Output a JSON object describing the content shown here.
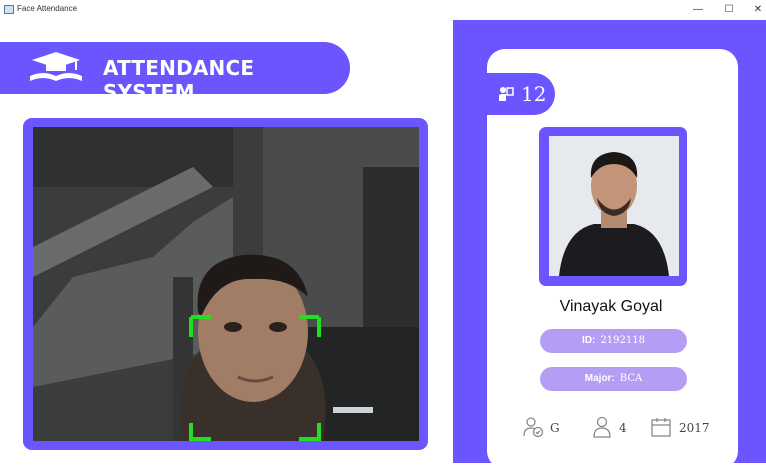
{
  "window": {
    "title": "Face Attendance",
    "minimize": "—",
    "maximize": "☐",
    "close": "✕"
  },
  "banner": {
    "title": "ATTENDANCE SYSTEM"
  },
  "student": {
    "total_attendance": "12",
    "name": "Vinayak Goyal",
    "id_label": "ID:",
    "id_value": "2192118",
    "major_label": "Major:",
    "major_value": "BCA",
    "standing": "G",
    "year": "4",
    "starting_year": "2017"
  },
  "colors": {
    "accent": "#6b55ff",
    "pill": "#b49ef5",
    "detector": "#22dd22"
  },
  "icons": {
    "logo": "graduation-cap-icon",
    "counter": "person-board-icon",
    "standing": "user-check-icon",
    "year": "user-icon",
    "starting_year": "calendar-icon"
  }
}
